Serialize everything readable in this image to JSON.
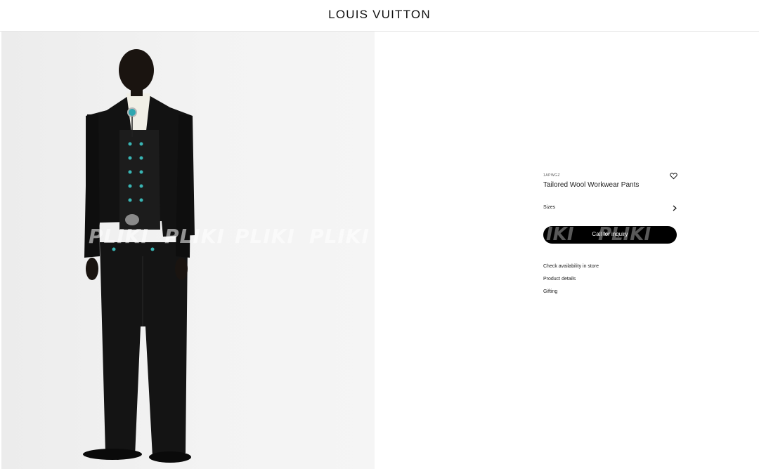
{
  "header": {
    "brand": "LOUIS VUITTON"
  },
  "gallery": {
    "watermark_text": "PLIKI"
  },
  "product": {
    "sku": "1APWGZ",
    "name": "Tailored Wool Workwear Pants",
    "sizes_label": "Sizes",
    "cta_label": "Call for inquiry",
    "cta_watermark_1": "IKI",
    "cta_watermark_2": "PLIKI",
    "links": [
      "Check availability in store",
      "Product details",
      "Gifting"
    ]
  }
}
